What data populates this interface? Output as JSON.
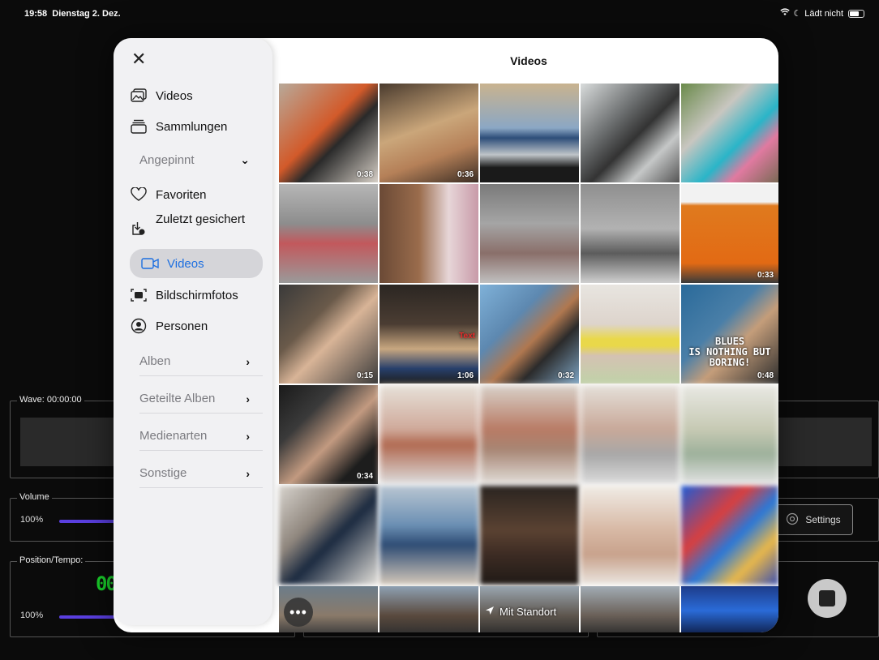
{
  "status_bar": {
    "time": "19:58",
    "date": "Dienstag 2. Dez.",
    "charging": "Lädt nicht"
  },
  "background_app": {
    "wave_label": "Wave: 00:00:00",
    "volume_label": "Volume",
    "volume_value": "100%",
    "position_label": "Position/Tempo:",
    "tempo_value": "100%",
    "digits": "00",
    "settings_label": "Settings",
    "accent_color": "#5a3fe0",
    "digit_color": "#19d12b"
  },
  "modal": {
    "title": "Videos"
  },
  "sidebar": {
    "top_items": [
      {
        "label": "Videos",
        "icon": "photo-library-icon"
      },
      {
        "label": "Sammlungen",
        "icon": "collections-icon"
      }
    ],
    "pinned_header": "Angepinnt",
    "pinned_items": [
      {
        "label": "Favoriten",
        "icon": "heart-icon"
      },
      {
        "label": "Zuletzt gesichert",
        "icon": "recently-saved-icon"
      },
      {
        "label": "Videos",
        "icon": "video-icon",
        "active": true
      },
      {
        "label": "Bildschirmfotos",
        "icon": "screenshot-icon"
      },
      {
        "label": "Personen",
        "icon": "person-icon"
      }
    ],
    "sections": [
      {
        "label": "Alben"
      },
      {
        "label": "Geteilte Alben"
      },
      {
        "label": "Medienarten"
      },
      {
        "label": "Sonstige"
      }
    ]
  },
  "grid": {
    "durations": {
      "r0c0": "0:38",
      "r0c1": "0:36",
      "r1c4": "0:33",
      "r2c0": "0:15",
      "r2c1": "1:06",
      "r2c2": "0:32",
      "r2c4": "0:48",
      "r3c0": "0:34"
    },
    "overlay_text": {
      "blues_line1": "BLUES",
      "blues_line2": "IS NOTHING BUT",
      "blues_line3": "BORING!",
      "red_text": "Text"
    }
  },
  "bottom": {
    "location_label": "Mit Standort",
    "more_label": "•••"
  }
}
